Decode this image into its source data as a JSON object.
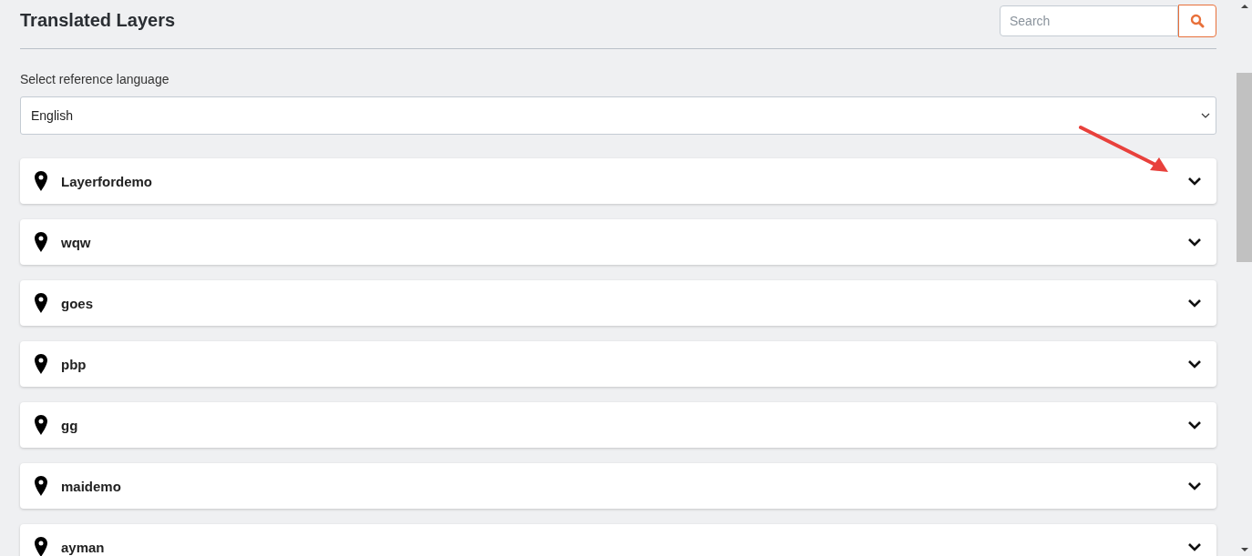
{
  "header": {
    "title": "Translated Layers",
    "search": {
      "placeholder": "Search"
    }
  },
  "language": {
    "label": "Select reference language",
    "value": "English"
  },
  "layers": [
    {
      "name": "Layerfordemo",
      "expanded": false
    },
    {
      "name": "wqw",
      "expanded": false
    },
    {
      "name": "goes",
      "expanded": false
    },
    {
      "name": "pbp",
      "expanded": false
    },
    {
      "name": "gg",
      "expanded": false
    },
    {
      "name": "maidemo",
      "expanded": false
    },
    {
      "name": "ayman",
      "expanded": false
    }
  ]
}
